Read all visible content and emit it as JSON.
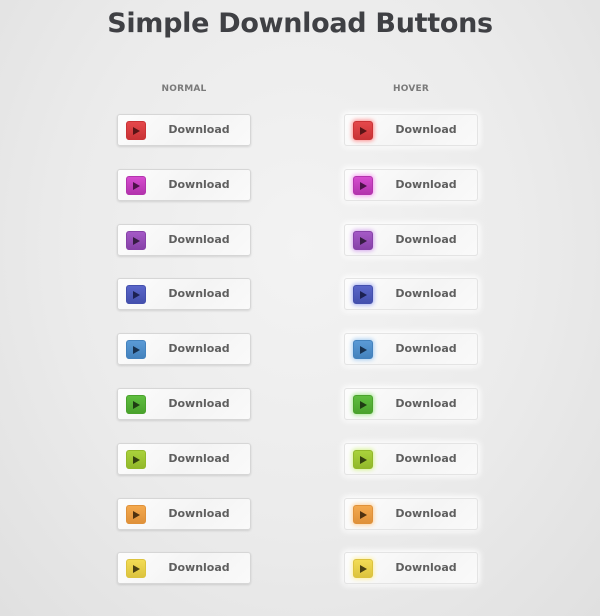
{
  "title": "Simple Download Buttons",
  "columns": {
    "normal": "NORMAL",
    "hover": "HOVER"
  },
  "buttons": [
    {
      "color": "red",
      "label": "Download",
      "fill": "#e5484b",
      "border": "#c93336",
      "glow": "#ff8a8a",
      "arrow": "#5a1416"
    },
    {
      "color": "magenta",
      "label": "Download",
      "fill": "#d64ccf",
      "border": "#b334ad",
      "glow": "#f59af0",
      "arrow": "#4d1249"
    },
    {
      "color": "purple",
      "label": "Download",
      "fill": "#a459c6",
      "border": "#8742a8",
      "glow": "#d4a4ec",
      "arrow": "#361c44"
    },
    {
      "color": "indigo",
      "label": "Download",
      "fill": "#5a66c9",
      "border": "#4450ad",
      "glow": "#a7b0f2",
      "arrow": "#1c2152"
    },
    {
      "color": "blue",
      "label": "Download",
      "fill": "#5a9ad6",
      "border": "#4482bd",
      "glow": "#a6cdf2",
      "arrow": "#173150"
    },
    {
      "color": "green",
      "label": "Download",
      "fill": "#5fbe3f",
      "border": "#4aa22d",
      "glow": "#a8e893",
      "arrow": "#1f3d14"
    },
    {
      "color": "lime",
      "label": "Download",
      "fill": "#a9d23c",
      "border": "#92b82b",
      "glow": "#d6f38f",
      "arrow": "#33410f"
    },
    {
      "color": "orange",
      "label": "Download",
      "fill": "#f4a94e",
      "border": "#df913a",
      "glow": "#ffd39d",
      "arrow": "#4f3210"
    },
    {
      "color": "yellow",
      "label": "Download",
      "fill": "#f3dc55",
      "border": "#dcc33e",
      "glow": "#fff0a0",
      "arrow": "#4a4012"
    }
  ]
}
